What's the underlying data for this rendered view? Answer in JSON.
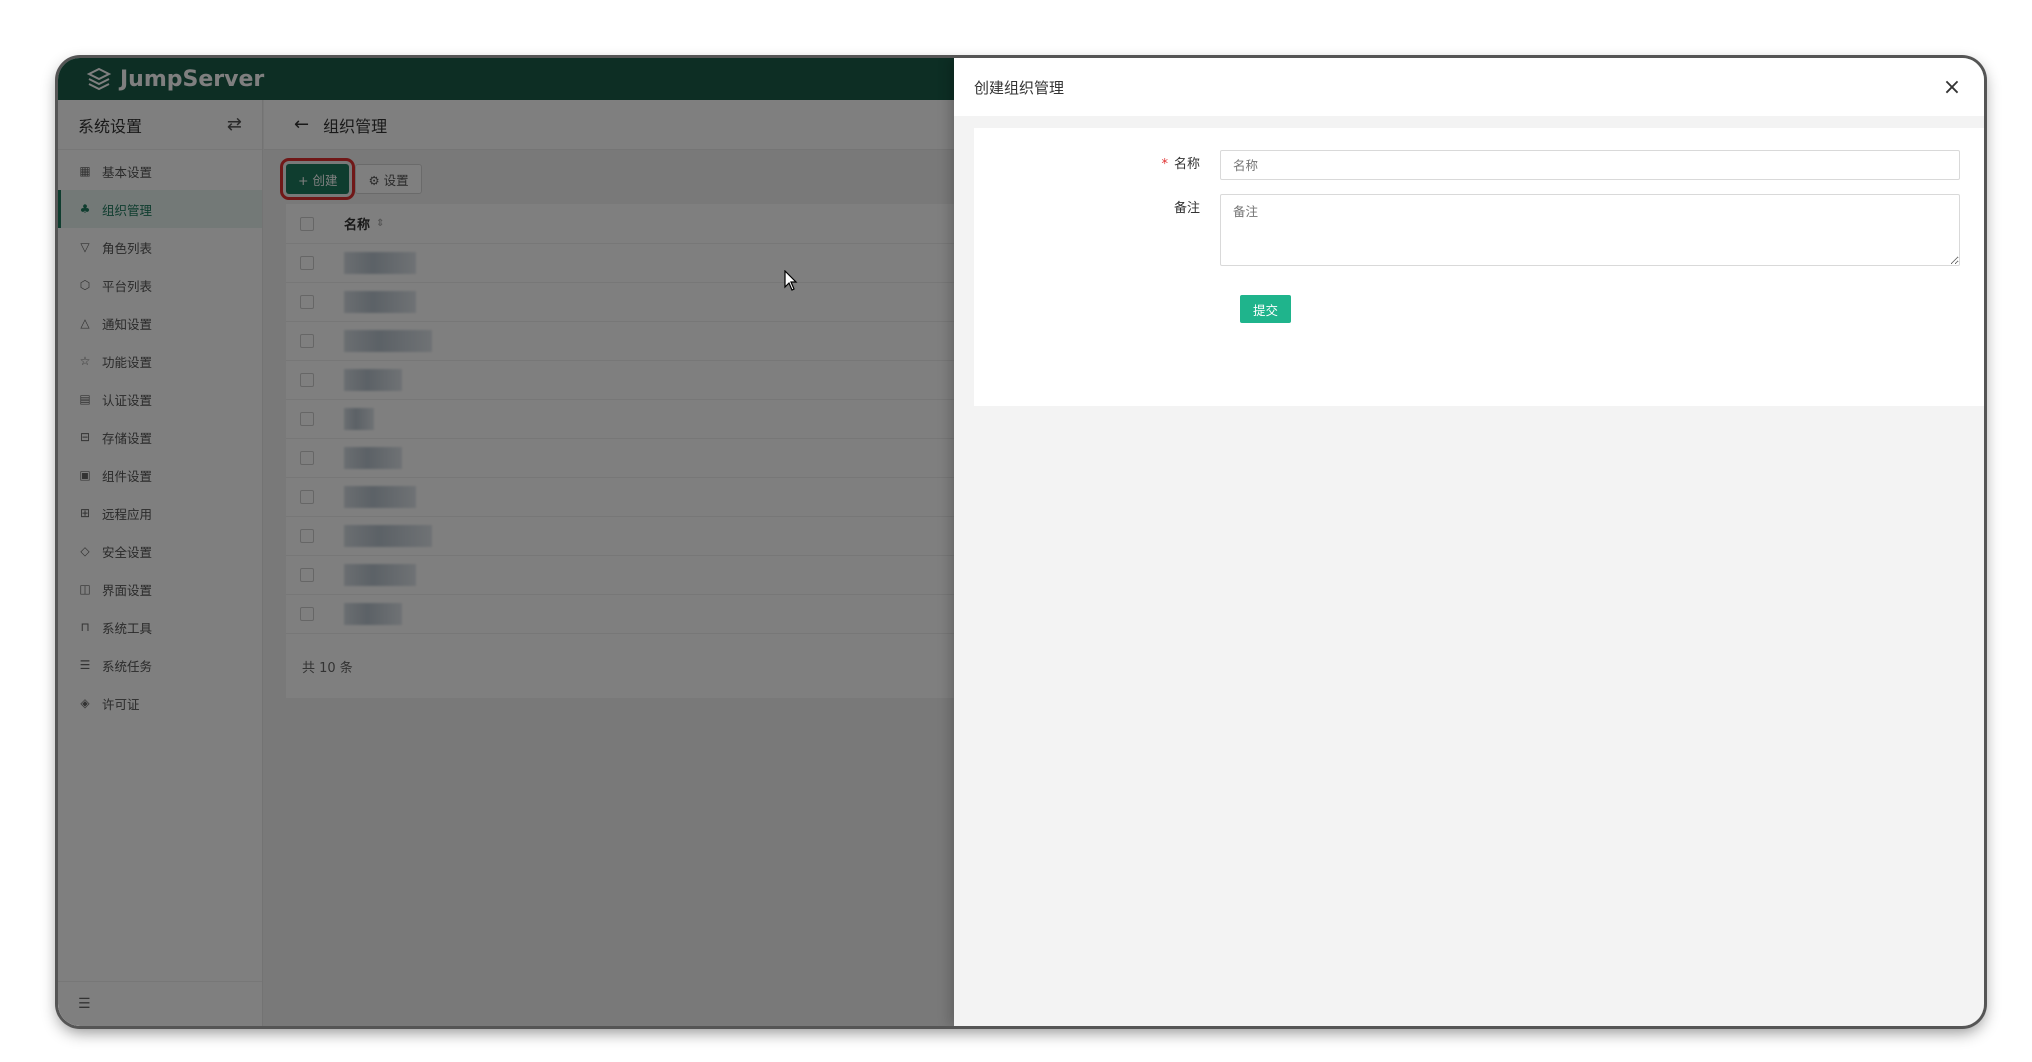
{
  "brand": {
    "name": "JumpServer"
  },
  "sidebar": {
    "title": "系统设置",
    "items": [
      {
        "label": "基本设置",
        "icon": "grid-icon"
      },
      {
        "label": "组织管理",
        "icon": "org-tree-icon",
        "active": true
      },
      {
        "label": "角色列表",
        "icon": "shirt-icon"
      },
      {
        "label": "平台列表",
        "icon": "cube-icon"
      },
      {
        "label": "通知设置",
        "icon": "bell-icon"
      },
      {
        "label": "功能设置",
        "icon": "star-icon"
      },
      {
        "label": "认证设置",
        "icon": "id-card-icon"
      },
      {
        "label": "存储设置",
        "icon": "inbox-icon"
      },
      {
        "label": "组件设置",
        "icon": "monitor-icon"
      },
      {
        "label": "远程应用",
        "icon": "apps-icon"
      },
      {
        "label": "安全设置",
        "icon": "shield-icon"
      },
      {
        "label": "界面设置",
        "icon": "layout-icon"
      },
      {
        "label": "系统工具",
        "icon": "toolbox-icon"
      },
      {
        "label": "系统任务",
        "icon": "task-icon"
      },
      {
        "label": "许可证",
        "icon": "license-icon"
      }
    ]
  },
  "page": {
    "title": "组织管理"
  },
  "toolbar": {
    "create_label": "+ 创建",
    "setting_label": "⚙ 设置"
  },
  "table": {
    "header_name": "名称",
    "row_count": 10,
    "footer": "共 10 条"
  },
  "drawer": {
    "title": "创建组织管理",
    "name_label": "名称",
    "name_placeholder": "名称",
    "comment_label": "备注",
    "comment_placeholder": "备注",
    "submit_label": "提交"
  },
  "colors": {
    "brand_green": "#1a5c48",
    "primary": "#1f7a5e",
    "submit": "#1fb48c",
    "highlight_red": "#e03030"
  }
}
